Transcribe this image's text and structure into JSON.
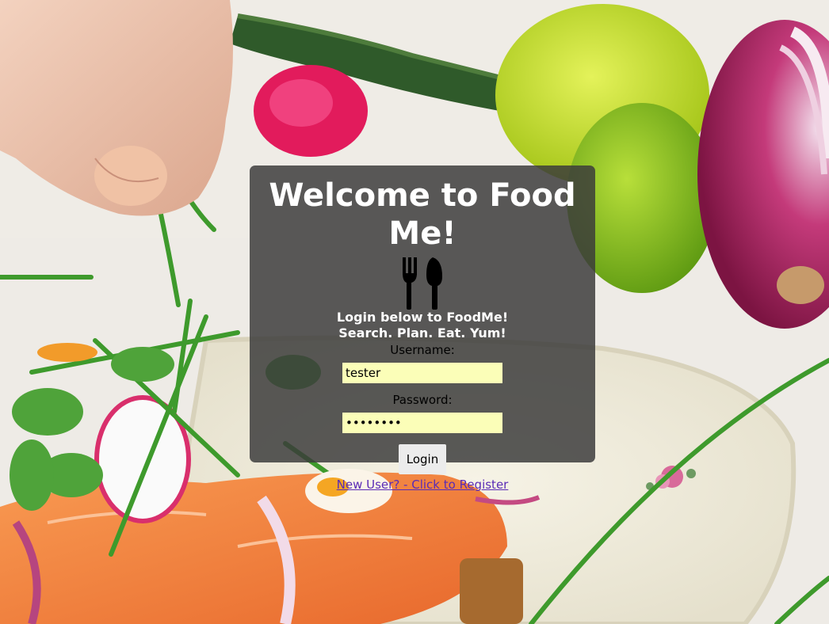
{
  "page": {
    "title": "Welcome to Food Me!",
    "tagline_1": "Login below to FoodMe!",
    "tagline_2": "Search. Plan. Eat. Yum!"
  },
  "login_form": {
    "username_label": "Username:",
    "username_value": "tester",
    "password_label": "Password:",
    "password_value": "password",
    "login_button": "Login",
    "register_link": "New User? - Click to Register"
  },
  "icons": {
    "logo": "fork-and-knife-icon"
  },
  "colors": {
    "card_background": "#3a3a3a",
    "input_background": "#fbfeb8",
    "link": "#5a2bb6",
    "title_text": "#ffffff"
  }
}
